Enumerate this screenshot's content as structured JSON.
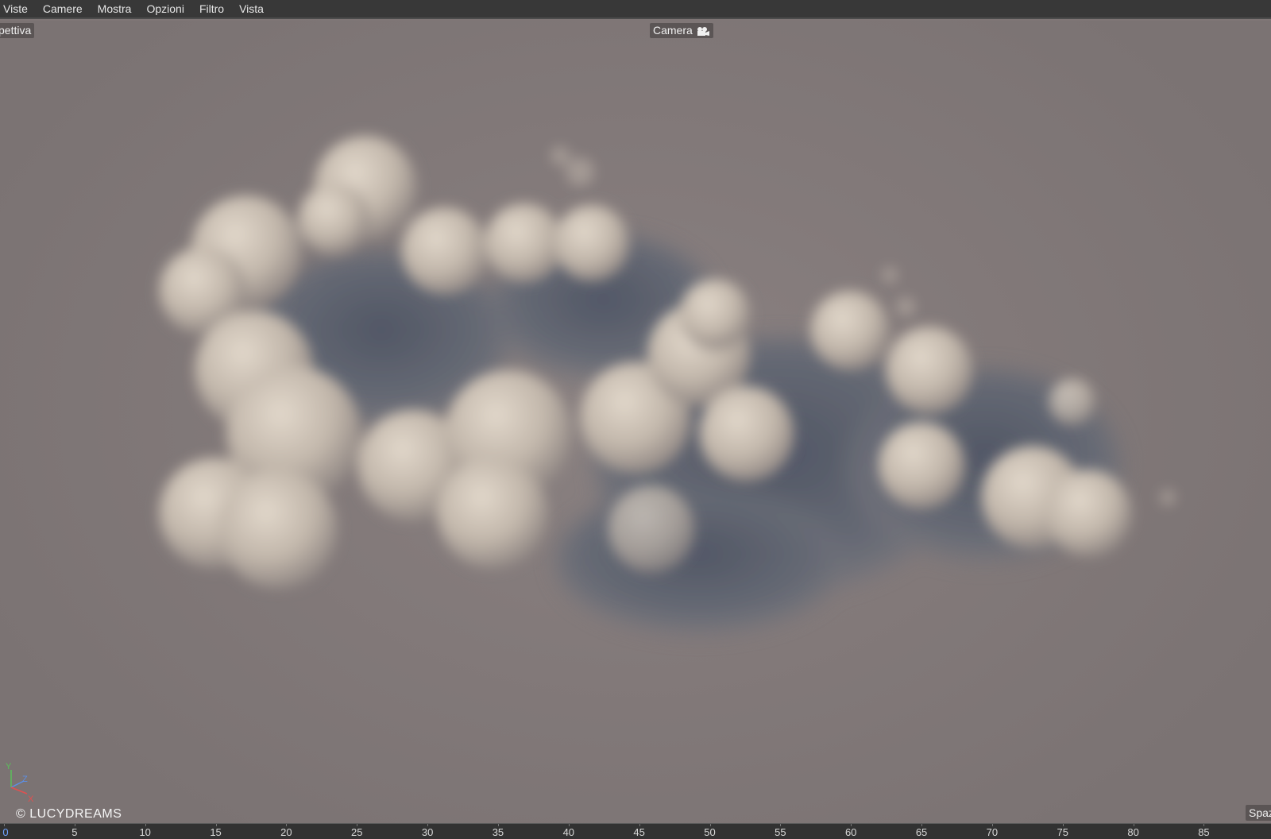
{
  "menubar": {
    "items": [
      {
        "label": "Viste"
      },
      {
        "label": "Camere"
      },
      {
        "label": "Mostra"
      },
      {
        "label": "Opzioni"
      },
      {
        "label": "Filtro"
      },
      {
        "label": "Vista"
      }
    ]
  },
  "viewport": {
    "projection_label": "pettiva",
    "camera_label": "Camera",
    "camera_icon": "camera-icon",
    "corner_label": "Spaz",
    "watermark": "© LUCYDREAMS",
    "axes": {
      "y": "Y",
      "z": "Z",
      "x": "X"
    },
    "colors": {
      "background": "#837a7a",
      "smoke_light": "#d8cdc0",
      "smoke_shadow": "#5b616e"
    }
  },
  "timeline": {
    "current_frame": "0",
    "ticks": [
      "0",
      "5",
      "10",
      "15",
      "20",
      "25",
      "30",
      "35",
      "40",
      "45",
      "50",
      "55",
      "60",
      "65",
      "70",
      "75",
      "80",
      "85"
    ]
  }
}
